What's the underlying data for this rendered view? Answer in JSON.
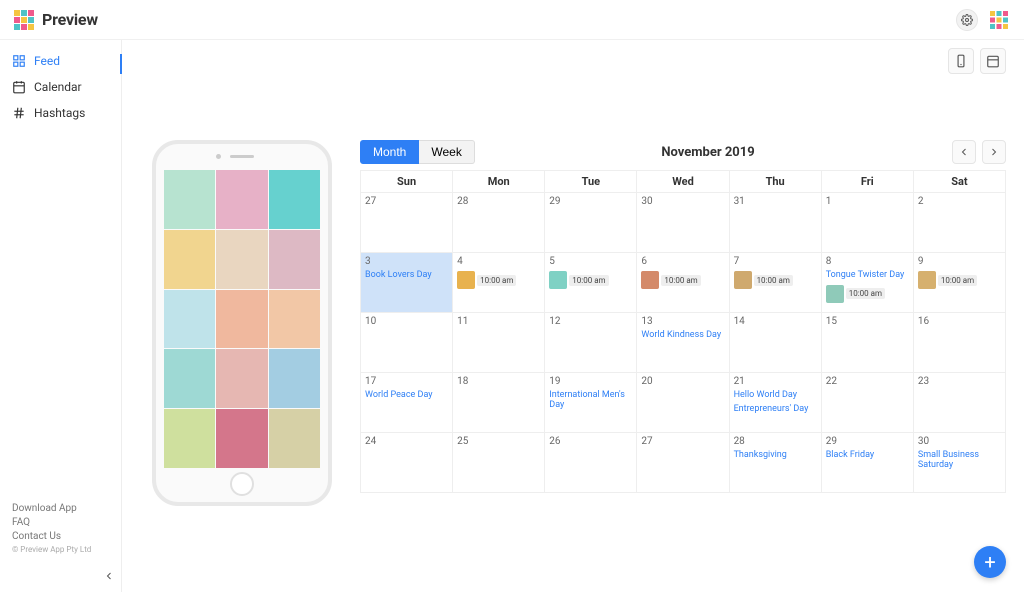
{
  "brand": {
    "name": "Preview"
  },
  "sidebar": {
    "items": [
      {
        "label": "Feed",
        "icon": "grid"
      },
      {
        "label": "Calendar",
        "icon": "calendar"
      },
      {
        "label": "Hashtags",
        "icon": "hash"
      }
    ]
  },
  "footer": {
    "links": [
      "Download App",
      "FAQ",
      "Contact Us"
    ],
    "copyright": "© Preview App Pty Ltd"
  },
  "toolbar": {
    "month_label": "Month",
    "week_label": "Week",
    "title": "November 2019"
  },
  "weekdays": [
    "Sun",
    "Mon",
    "Tue",
    "Wed",
    "Thu",
    "Fri",
    "Sat"
  ],
  "feed_colors": [
    "#b7e3d0",
    "#e7b1c7",
    "#66d1cf",
    "#f1d58f",
    "#e9d6c0",
    "#ddb9c4",
    "#bfe3ea",
    "#f0b89e",
    "#f2c7a6",
    "#9ed9d4",
    "#e6b7b2",
    "#a3cde2",
    "#cfe09e",
    "#d4768b",
    "#d6d0a6"
  ],
  "calendar": {
    "rows": [
      [
        {
          "n": "27",
          "out": true
        },
        {
          "n": "28",
          "out": true
        },
        {
          "n": "29",
          "out": true
        },
        {
          "n": "30",
          "out": true
        },
        {
          "n": "31",
          "out": true
        },
        {
          "n": "1"
        },
        {
          "n": "2"
        }
      ],
      [
        {
          "n": "3",
          "today": true,
          "events": [
            "Book Lovers Day"
          ]
        },
        {
          "n": "4",
          "post": {
            "time": "10:00 am",
            "c": "#e8b24e"
          }
        },
        {
          "n": "5",
          "post": {
            "time": "10:00 am",
            "c": "#7fd1c4"
          }
        },
        {
          "n": "6",
          "post": {
            "time": "10:00 am",
            "c": "#d48a6a"
          }
        },
        {
          "n": "7",
          "post": {
            "time": "10:00 am",
            "c": "#cfa96e"
          }
        },
        {
          "n": "8",
          "events": [
            "Tongue Twister Day"
          ],
          "post": {
            "time": "10:00 am",
            "c": "#8fcab9"
          }
        },
        {
          "n": "9",
          "post": {
            "time": "10:00 am",
            "c": "#d6b06e"
          }
        }
      ],
      [
        {
          "n": "10"
        },
        {
          "n": "11"
        },
        {
          "n": "12"
        },
        {
          "n": "13",
          "events": [
            "World Kindness Day"
          ]
        },
        {
          "n": "14"
        },
        {
          "n": "15"
        },
        {
          "n": "16"
        }
      ],
      [
        {
          "n": "17",
          "events": [
            "World Peace Day"
          ]
        },
        {
          "n": "18"
        },
        {
          "n": "19",
          "events": [
            "International Men's Day"
          ]
        },
        {
          "n": "20"
        },
        {
          "n": "21",
          "events": [
            "Hello World Day",
            "Entrepreneurs' Day"
          ]
        },
        {
          "n": "22"
        },
        {
          "n": "23"
        }
      ],
      [
        {
          "n": "24"
        },
        {
          "n": "25"
        },
        {
          "n": "26"
        },
        {
          "n": "27"
        },
        {
          "n": "28",
          "events": [
            "Thanksgiving"
          ]
        },
        {
          "n": "29",
          "events": [
            "Black Friday"
          ]
        },
        {
          "n": "30",
          "events": [
            "Small Business Saturday"
          ]
        }
      ]
    ]
  }
}
